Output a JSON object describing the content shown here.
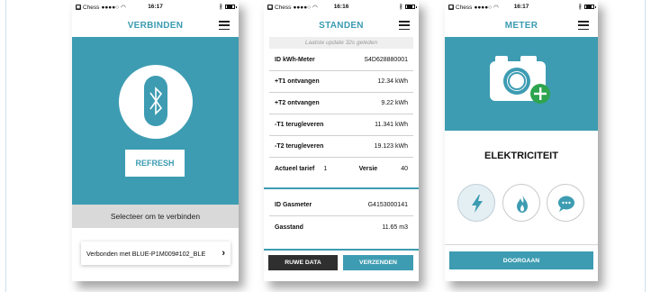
{
  "status_bars": [
    {
      "carrier": "Chess",
      "time": "16:17"
    },
    {
      "carrier": "Chess",
      "time": "16:16"
    },
    {
      "carrier": "Chess",
      "time": "16:17"
    }
  ],
  "screen_connect": {
    "title": "VERBINDEN",
    "refresh_label": "REFRESH",
    "select_prompt": "Selecteer om te verbinden",
    "connected_text": "Verbonden met BLUE-P1M009#102_BLE",
    "chevron": "›",
    "icons": {
      "bluetooth": "bluetooth-icon",
      "menu": "hamburger-icon"
    }
  },
  "screen_standen": {
    "title": "STANDEN",
    "last_update": "Laatste update 32s geleden",
    "electricity_rows": [
      {
        "label": "ID kWh-Meter",
        "value": "S4D628880001"
      },
      {
        "label": "+T1 ontvangen",
        "value": "12.34 kWh"
      },
      {
        "label": "+T2 ontvangen",
        "value": "9.22 kWh"
      },
      {
        "label": "-T1 terugleveren",
        "value": "11.341 kWh"
      },
      {
        "label": "-T2 terugleveren",
        "value": "19.123 kWh"
      }
    ],
    "tarief": {
      "label": "Actueel tarief",
      "value": "1",
      "versie_label": "Versie",
      "versie_value": "40"
    },
    "gas_rows": [
      {
        "label": "ID Gasmeter",
        "value": "G4153000141"
      },
      {
        "label": "Gasstand",
        "value": "11.65 m3"
      }
    ],
    "raw_button": "RUWE DATA",
    "send_button": "VERZENDEN"
  },
  "screen_meter": {
    "title": "METER",
    "meter_type": "ELEKTRICITEIT",
    "continue_button": "DOORGAAN",
    "icons": {
      "camera": "camera-add-icon",
      "electricity": "lightning-icon",
      "gas": "flame-icon",
      "other": "chat-icon"
    }
  },
  "colors": {
    "accent": "#3d9cb2",
    "dark_button": "#2f2f2f",
    "add_badge": "#2ea44f"
  }
}
